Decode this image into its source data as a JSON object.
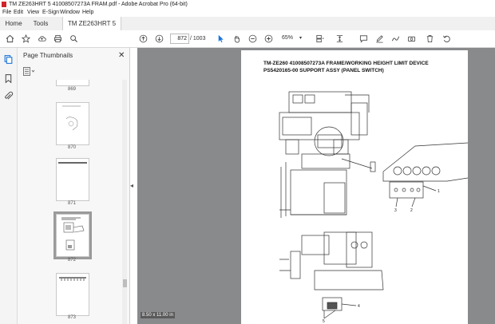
{
  "window": {
    "title": "TM ZE263HRT 5 41008507273A FRAM.pdf - Adobe Acrobat Pro (64-bit)"
  },
  "menu": [
    "File",
    "Edit",
    "View",
    "E-Sign",
    "Window",
    "Help"
  ],
  "tabs": {
    "home": "Home",
    "tools": "Tools",
    "document": "TM ZE263HRT 5 41..."
  },
  "toolbar": {
    "page_number": "872",
    "page_total": "/ 1003",
    "zoom": "65%"
  },
  "panel": {
    "title": "Page Thumbnails",
    "pages": [
      "869",
      "870",
      "871",
      "872",
      "873"
    ],
    "selected": "872"
  },
  "document": {
    "title_line1": "TM-ZE260 41008507273A FRAME/WORKING HEIGHT LIMIT DEVICE",
    "title_line2": "PS5420165-00 SUPPORT ASSY (PANEL SWITCH)",
    "callouts": [
      "1",
      "2",
      "3",
      "4",
      "5"
    ],
    "page_size": "8.50 x 11.00 in"
  }
}
